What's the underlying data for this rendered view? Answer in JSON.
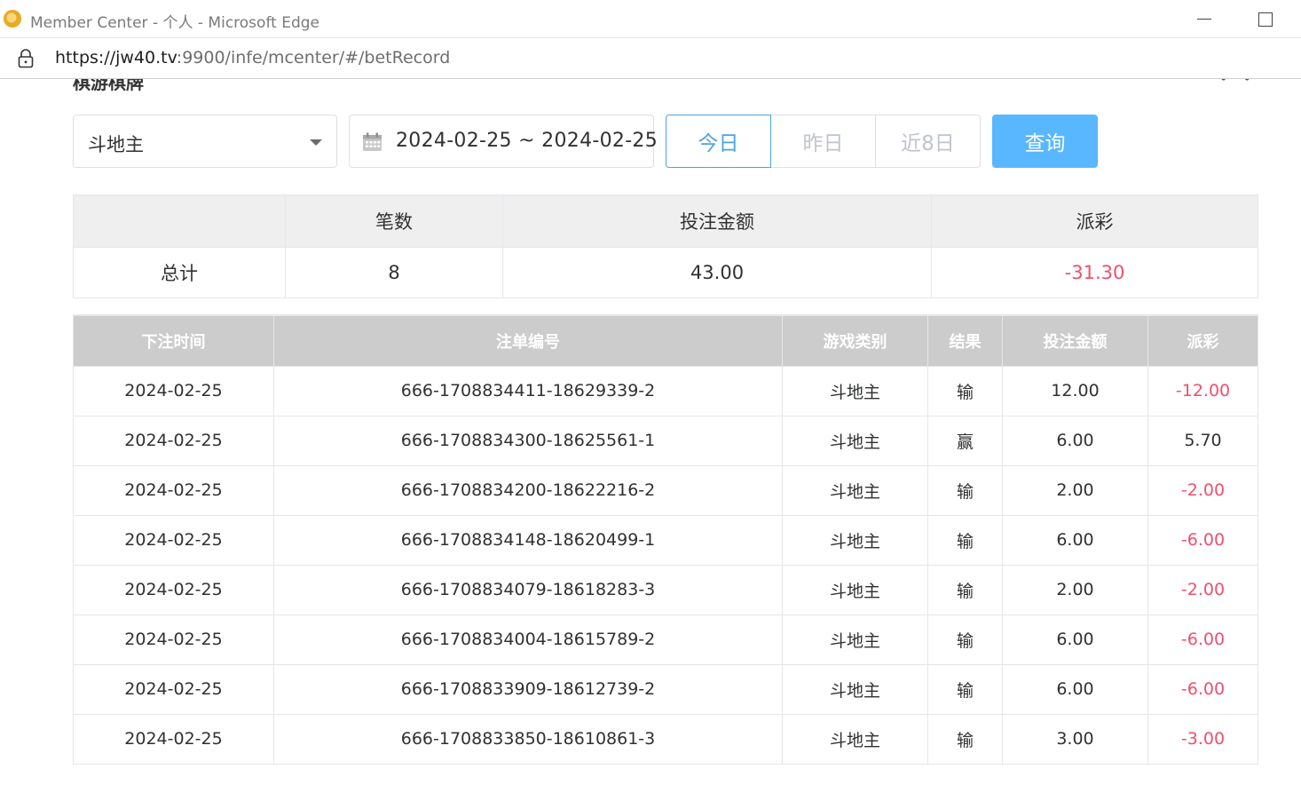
{
  "window": {
    "title": "Member Center - 个人 - Microsoft Edge",
    "url_prefix": "https://jw40.tv",
    "url_rest": ":9900/infe/mcenter/#/betRecord"
  },
  "page": {
    "cut_title": "棋游棋牌"
  },
  "filters": {
    "game_select": "斗地主",
    "date_range": "2024-02-25 ~ 2024-02-25",
    "quick_today": "今日",
    "quick_yesterday": "昨日",
    "quick_last8": "近8日",
    "query_label": "查询"
  },
  "summary": {
    "headers": [
      "",
      "笔数",
      "投注金额",
      "派彩"
    ],
    "row_label": "总计",
    "count": "8",
    "bet_amount": "43.00",
    "payout": "-31.30"
  },
  "records": {
    "headers": [
      "下注时间",
      "注单编号",
      "游戏类别",
      "结果",
      "投注金额",
      "派彩"
    ],
    "rows": [
      {
        "time": "2024-02-25",
        "id": "666-1708834411-18629339-2",
        "game": "斗地主",
        "result": "输",
        "bet": "12.00",
        "payout": "-12.00"
      },
      {
        "time": "2024-02-25",
        "id": "666-1708834300-18625561-1",
        "game": "斗地主",
        "result": "赢",
        "bet": "6.00",
        "payout": "5.70"
      },
      {
        "time": "2024-02-25",
        "id": "666-1708834200-18622216-2",
        "game": "斗地主",
        "result": "输",
        "bet": "2.00",
        "payout": "-2.00"
      },
      {
        "time": "2024-02-25",
        "id": "666-1708834148-18620499-1",
        "game": "斗地主",
        "result": "输",
        "bet": "6.00",
        "payout": "-6.00"
      },
      {
        "time": "2024-02-25",
        "id": "666-1708834079-18618283-3",
        "game": "斗地主",
        "result": "输",
        "bet": "2.00",
        "payout": "-2.00"
      },
      {
        "time": "2024-02-25",
        "id": "666-1708834004-18615789-2",
        "game": "斗地主",
        "result": "输",
        "bet": "6.00",
        "payout": "-6.00"
      },
      {
        "time": "2024-02-25",
        "id": "666-1708833909-18612739-2",
        "game": "斗地主",
        "result": "输",
        "bet": "6.00",
        "payout": "-6.00"
      },
      {
        "time": "2024-02-25",
        "id": "666-1708833850-18610861-3",
        "game": "斗地主",
        "result": "输",
        "bet": "3.00",
        "payout": "-3.00"
      }
    ]
  },
  "colors": {
    "negative": "#f0506e",
    "primary": "#58b7ff",
    "active_border": "#4aa3e6"
  }
}
